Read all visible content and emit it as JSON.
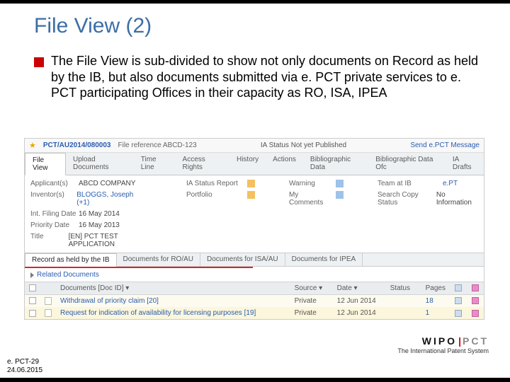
{
  "slide": {
    "title": "File View (2)",
    "bullet": "The File View is sub-divided to show not only documents on Record as held by the IB, but also documents submitted via e. PCT private services to e. PCT participating Offices in their capacity as RO, ISA, IPEA"
  },
  "header": {
    "pct_id": "PCT/AU2014/080003",
    "file_ref": "File reference ABCD-123",
    "ia_status": "IA Status Not yet Published",
    "send_msg": "Send e.PCT Message"
  },
  "tabs": [
    "File View",
    "Upload Documents",
    "Time Line",
    "Access Rights",
    "History",
    "Actions",
    "Bibliographic Data",
    "Bibliographic Data Ofc",
    "IA Drafts"
  ],
  "info": {
    "col1": [
      {
        "k": "Applicant(s)",
        "v": "ABCD COMPANY"
      },
      {
        "k": "Inventor(s)",
        "v": "BLOGGS, Joseph (+1)"
      },
      {
        "k": "Int. Filing Date",
        "v": "16 May 2014"
      },
      {
        "k": "Priority Date",
        "v": "16 May 2013"
      },
      {
        "k": "Title",
        "v": "[EN] PCT TEST APPLICATION"
      }
    ],
    "col2": [
      {
        "k": "IA Status Report",
        "v": ""
      },
      {
        "k": "Portfolio",
        "v": ""
      }
    ],
    "col3": [
      {
        "k": "Warning",
        "v": ""
      },
      {
        "k": "My Comments",
        "v": ""
      }
    ],
    "col4": [
      {
        "k": "Team at IB",
        "v": "e.PT"
      },
      {
        "k": "Search Copy Status",
        "v": "No Information"
      }
    ]
  },
  "sub_tabs": [
    "Record as held by the IB",
    "Documents for RO/AU",
    "Documents for ISA/AU",
    "Documents for IPEA"
  ],
  "related": "Related Documents",
  "doc_table": {
    "headers": [
      "",
      "",
      "Documents [Doc ID] ▾",
      "Source ▾",
      "Date ▾",
      "Status",
      "Pages",
      "",
      ""
    ],
    "rows": [
      {
        "name": "Withdrawal of priority claim [20]",
        "source": "Private",
        "date": "12 Jun 2014",
        "status": "",
        "pages": "18"
      },
      {
        "name": "Request for indication of availability for licensing purposes [19]",
        "source": "Private",
        "date": "12 Jun 2014",
        "status": "",
        "pages": "1"
      }
    ]
  },
  "branding": {
    "wipo": "WIPO",
    "pct": "PCT",
    "tagline": "The International Patent System"
  },
  "footer": {
    "code": "e. PCT-29",
    "date": "24.06.2015"
  }
}
